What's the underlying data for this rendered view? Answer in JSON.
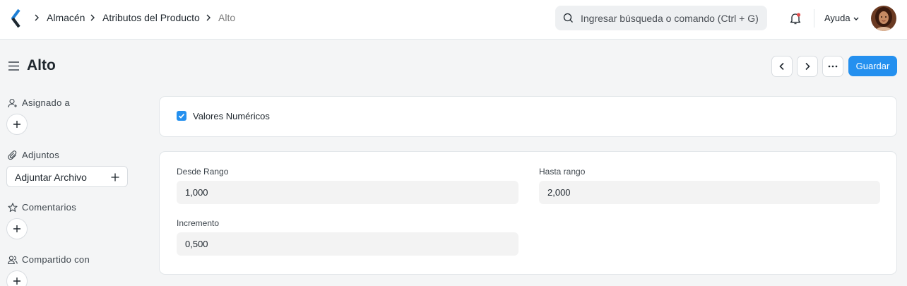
{
  "navbar": {
    "logo_icon": "app-logo-chevron",
    "breadcrumbs": [
      "Almacén",
      "Atributos del Producto",
      "Alto"
    ],
    "search_placeholder": "Ingresar búsqueda o comando (Ctrl + G)",
    "help_label": "Ayuda",
    "notification_icon": "bell-icon"
  },
  "page": {
    "title": "Alto",
    "save_label": "Guardar"
  },
  "sidebar": {
    "assigned_label": "Asignado a",
    "attachments_label": "Adjuntos",
    "attach_button_label": "Adjuntar Archivo",
    "comments_label": "Comentarios",
    "shared_label": "Compartido con"
  },
  "form": {
    "numeric_checkbox_label": "Valores Numéricos",
    "numeric_checked": true,
    "from_range_label": "Desde Rango",
    "from_range_value": "1,000",
    "to_range_label": "Hasta rango",
    "to_range_value": "2,000",
    "increment_label": "Incremento",
    "increment_value": "0,500"
  },
  "colors": {
    "primary": "#2490ef",
    "background": "#f4f5f6",
    "card": "#ffffff",
    "input_bg": "#f3f3f3",
    "notification_dot": "#e24c4c"
  }
}
